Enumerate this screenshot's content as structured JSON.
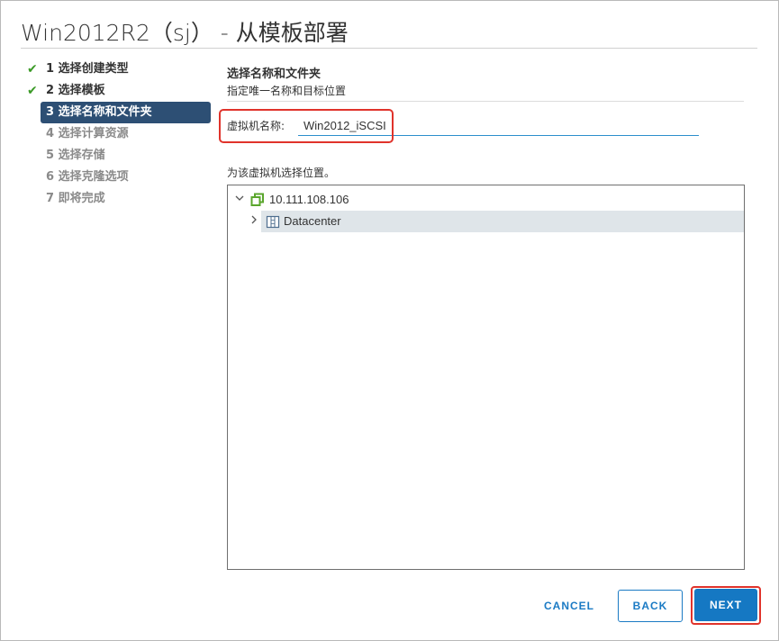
{
  "window": {
    "title": "Win2012R2（sj） - 从模板部署"
  },
  "wizard": {
    "steps": [
      {
        "label": "1 选择创建类型",
        "state": "done"
      },
      {
        "label": "2 选择模板",
        "state": "done"
      },
      {
        "label": "3 选择名称和文件夹",
        "state": "active"
      },
      {
        "label": "4 选择计算资源",
        "state": "future"
      },
      {
        "label": "5 选择存储",
        "state": "future"
      },
      {
        "label": "6 选择克隆选项",
        "state": "future"
      },
      {
        "label": "7 即将完成",
        "state": "future"
      }
    ],
    "check_glyph": "✔"
  },
  "content": {
    "section_title": "选择名称和文件夹",
    "section_subtitle": "指定唯一名称和目标位置",
    "vm_name_label": "虚拟机名称:",
    "vm_name_value": "Win2012_iSCSI",
    "location_label": "为该虚拟机选择位置。"
  },
  "tree": {
    "root": {
      "label": "10.111.108.106",
      "icon": "vcenter-icon",
      "expanded": true
    },
    "children": [
      {
        "label": "Datacenter",
        "icon": "datacenter-icon",
        "expanded": false,
        "selected": true
      }
    ]
  },
  "footer": {
    "cancel_label": "CANCEL",
    "back_label": "BACK",
    "next_label": "NEXT"
  },
  "colors": {
    "accent": "#1578c3",
    "active_step_bg": "#2d4f74",
    "check": "#3b9a27",
    "highlight": "#e0332b",
    "vcenter_icon": "#5aa62c"
  }
}
